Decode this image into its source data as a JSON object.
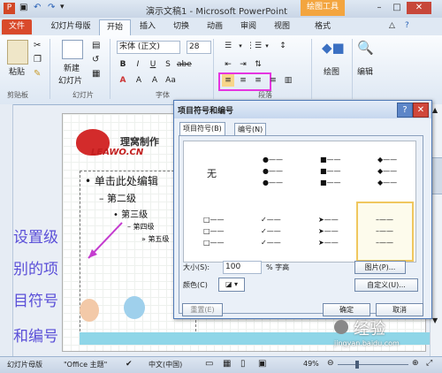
{
  "title_bar": {
    "title": "演示文稿1 - Microsoft PowerPoint",
    "drawing_tools": "绘图工具",
    "quick_icons": [
      "save-icon",
      "undo-icon",
      "redo-icon"
    ]
  },
  "tabs": [
    "文件",
    "幻灯片母版",
    "开始",
    "插入",
    "切换",
    "动画",
    "审阅",
    "视图",
    "格式"
  ],
  "ribbon": {
    "paste": "粘贴",
    "new_slide": "新建",
    "slide": "幻灯片",
    "font_name": "宋体 (正文)",
    "font_size": "28",
    "draw": "绘图",
    "edit": "编辑",
    "groups": [
      "剪贴板",
      "幻灯片",
      "字体",
      "段落"
    ]
  },
  "slide": {
    "logo_text": "理窝制作",
    "logo_sub": "LEAWO.CN",
    "levels": [
      "• 单击此处编辑",
      "– 第二级",
      "• 第三级",
      "– 第四级",
      "» 第五级"
    ]
  },
  "overlay": {
    "lines": [
      "设置级",
      "别的项",
      "目符号",
      "和编号"
    ]
  },
  "dialog": {
    "title": "项目符号和编号",
    "tabs": [
      "项目符号(B)",
      "编号(N)"
    ],
    "none_label": "无",
    "size_label": "大小(S):",
    "size_value": "100",
    "size_unit": "% 字高",
    "color_label": "颜色(C)",
    "picture_button": "图片(P)...",
    "custom_button": "自定义(U)...",
    "reset_button": "重置(E)",
    "ok_button": "确定",
    "cancel_button": "取消"
  },
  "status_bar": {
    "view": "幻灯片母版",
    "theme": "\"Office 主题\"",
    "language": "中文(中国)",
    "zoom": "49%"
  },
  "watermark": "经验",
  "watermark_url": "jingyan.baidu.com",
  "colors": {
    "accent": "#e535e0",
    "annotation": "#5a4fd8",
    "file_tab": "#d94a2b",
    "drawing_tools": "#f3a53f"
  }
}
